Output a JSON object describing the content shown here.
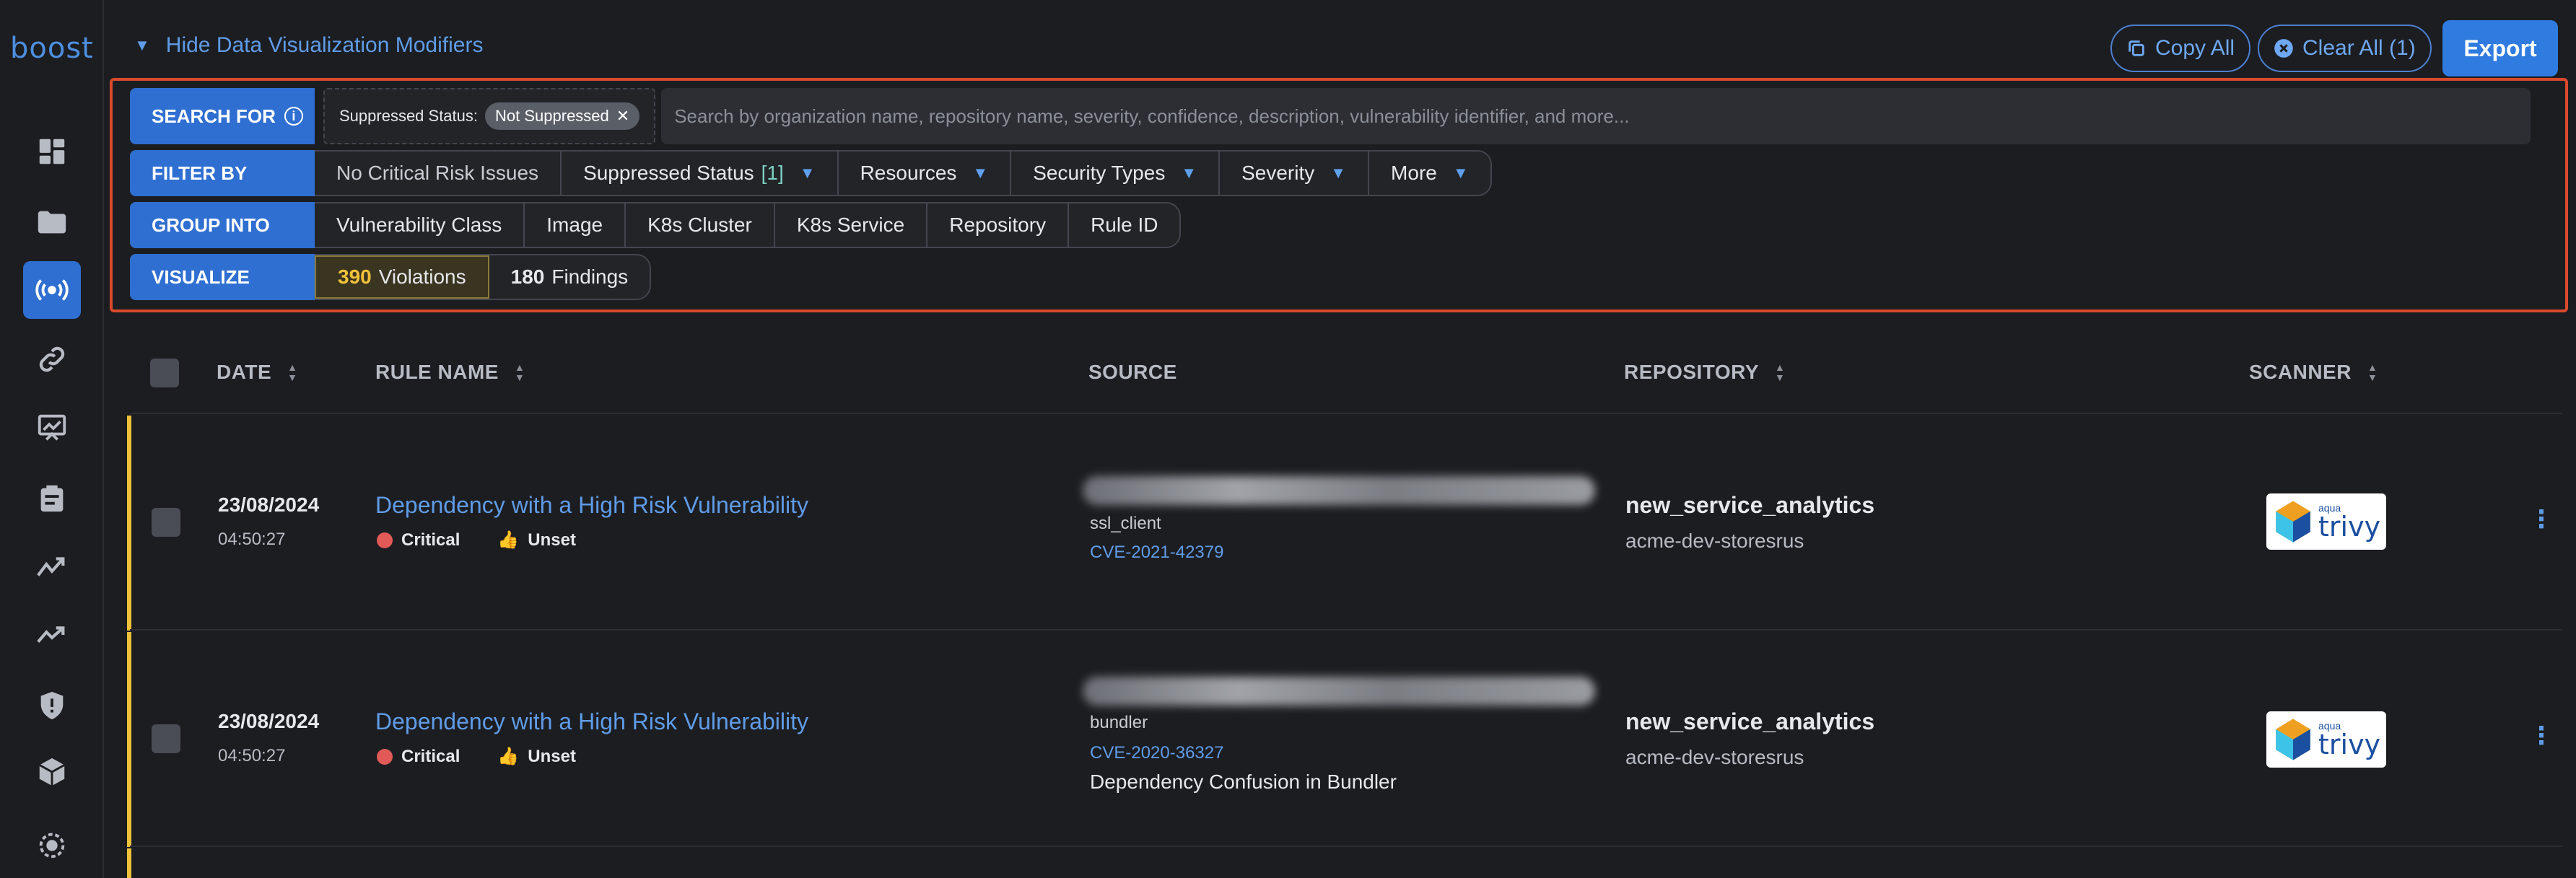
{
  "app": {
    "logo_text": "boost"
  },
  "sidebar": {
    "items": [
      {
        "name": "dashboard-icon",
        "active": false
      },
      {
        "name": "folder-icon",
        "active": false
      },
      {
        "name": "broadcast-icon",
        "active": true
      },
      {
        "name": "link-icon",
        "active": false
      },
      {
        "name": "presentation-chart-icon",
        "active": false
      },
      {
        "name": "clipboard-icon",
        "active": false
      },
      {
        "name": "trend-icon",
        "active": false
      },
      {
        "name": "trend-alt-icon",
        "active": false
      },
      {
        "name": "shield-alert-icon",
        "active": false
      },
      {
        "name": "package-icon",
        "active": false
      },
      {
        "name": "radar-icon",
        "active": false
      }
    ]
  },
  "header": {
    "toggle_label": "Hide Data Visualization Modifiers",
    "copy_all": "Copy All",
    "clear_all": "Clear All (1)",
    "export": "Export"
  },
  "modifiers": {
    "search_for": {
      "label": "SEARCH FOR",
      "chip_key": "Suppressed Status:",
      "chip_value": "Not Suppressed",
      "placeholder": "Search by organization name, repository name, severity, confidence, description, vulnerability identifier, and more..."
    },
    "filter_by": {
      "label": "FILTER BY",
      "items": [
        {
          "label": "No Critical Risk Issues",
          "count": "",
          "dropdown": false
        },
        {
          "label": "Suppressed Status",
          "count": "[1]",
          "dropdown": true
        },
        {
          "label": "Resources",
          "count": "",
          "dropdown": true
        },
        {
          "label": "Security Types",
          "count": "",
          "dropdown": true
        },
        {
          "label": "Severity",
          "count": "",
          "dropdown": true
        },
        {
          "label": "More",
          "count": "",
          "dropdown": true
        }
      ]
    },
    "group_into": {
      "label": "GROUP INTO",
      "items": [
        "Vulnerability Class",
        "Image",
        "K8s Cluster",
        "K8s Service",
        "Repository",
        "Rule ID"
      ]
    },
    "visualize": {
      "label": "VISUALIZE",
      "items": [
        {
          "count": "390",
          "label": "Violations",
          "selected": true
        },
        {
          "count": "180",
          "label": "Findings",
          "selected": false
        }
      ]
    }
  },
  "table": {
    "headers": {
      "date": "DATE",
      "rule_name": "RULE NAME",
      "source": "SOURCE",
      "repository": "REPOSITORY",
      "scanner": "SCANNER"
    },
    "rows": [
      {
        "date": "23/08/2024",
        "time": "04:50:27",
        "rule": "Dependency with a High Risk Vulnerability",
        "severity": "Critical",
        "status": "Unset",
        "package": "ssl_client",
        "cve": "CVE-2021-42379",
        "description": "",
        "repo": "new_service_analytics",
        "org": "acme-dev-storesrus",
        "scanner_brand": "aqua",
        "scanner_name": "trivy"
      },
      {
        "date": "23/08/2024",
        "time": "04:50:27",
        "rule": "Dependency with a High Risk Vulnerability",
        "severity": "Critical",
        "status": "Unset",
        "package": "bundler",
        "cve": "CVE-2020-36327",
        "description": "Dependency Confusion in Bundler",
        "repo": "new_service_analytics",
        "org": "acme-dev-storesrus",
        "scanner_brand": "aqua",
        "scanner_name": "trivy"
      }
    ]
  },
  "colors": {
    "accent": "#2f6fd1",
    "link": "#5f9ce8",
    "critical": "#e25a57",
    "row_marker": "#f0c23a",
    "highlight_border": "#d94a2c"
  }
}
